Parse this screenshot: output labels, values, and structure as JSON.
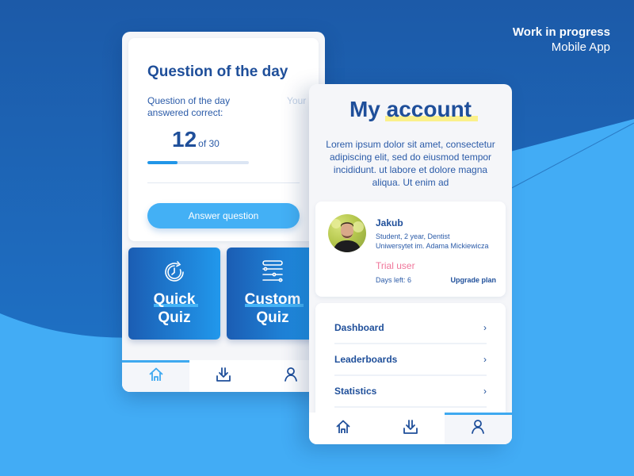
{
  "header": {
    "line1": "Work in progress",
    "line2": "Mobile App"
  },
  "home_screen": {
    "question_card": {
      "title_main": "Question of the ",
      "title_highlight": "day",
      "subtitle": "Question of the day answered correct:",
      "peek_text": "Your",
      "score_value": "12",
      "score_total": "of 30",
      "progress_fraction": 0.3,
      "button_label": "Answer question"
    },
    "tiles": [
      {
        "line1": "Quick",
        "line2": "Quiz",
        "icon": "clock-refresh-icon"
      },
      {
        "line1": "Custom",
        "line2": "Quiz",
        "icon": "sliders-icon"
      }
    ],
    "nav": [
      {
        "icon": "home-icon",
        "active": true
      },
      {
        "icon": "download-icon",
        "active": false
      },
      {
        "icon": "profile-icon",
        "active": false
      }
    ]
  },
  "account_screen": {
    "title_main": "My ",
    "title_highlight": "account",
    "description": "Lorem ipsum dolor sit amet, consectetur adipiscing elit, sed do eiusmod tempor incididunt. ut labore et dolore magna aliqua. Ut enim ad",
    "profile": {
      "name": "Jakub",
      "info_line1": "Student, 2 year, Dentist",
      "info_line2": "Uniwersytet im. Adama Mickiewicza",
      "status": "Trial user",
      "days_left": "Days left: 6",
      "upgrade_label": "Upgrade plan"
    },
    "menu": [
      {
        "label": "Dashboard",
        "chevron": "›"
      },
      {
        "label": "Leaderboards",
        "chevron": "›"
      },
      {
        "label": "Statistics",
        "chevron": "›"
      }
    ],
    "nav": [
      {
        "icon": "home-icon",
        "active": false
      },
      {
        "icon": "download-icon",
        "active": false
      },
      {
        "icon": "profile-icon",
        "active": true
      }
    ]
  },
  "colors": {
    "primary_dark": "#1f4f9a",
    "accent_blue": "#43b0f5",
    "highlight_yellow": "#fbf08a",
    "trial_pink": "#f0769a"
  }
}
